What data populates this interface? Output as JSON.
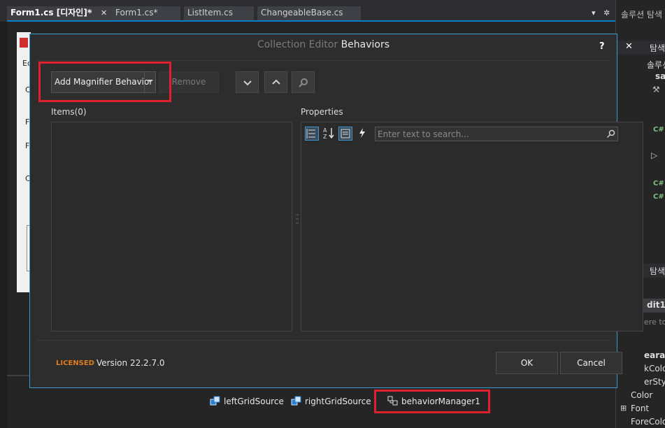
{
  "tabs": [
    {
      "label": "Form1.cs [디자인]*",
      "active": true
    },
    {
      "label": "Form1.cs*",
      "active": false
    },
    {
      "label": "ListItem.cs",
      "active": false
    },
    {
      "label": "ChangeableBase.cs",
      "active": false
    }
  ],
  "tab_controls": {
    "pin": "ᵖ",
    "close": "✕",
    "dropdown": "▾",
    "settings": "✲"
  },
  "form_fragments": [
    "Ed",
    "C",
    "F",
    "F",
    "C"
  ],
  "right_panel": {
    "title": "솔루션 탐색",
    "tab1": "탐색",
    "tree_root_label": "솔루션",
    "tree_item": "sa",
    "csharp": "C#",
    "tab2": "탐색",
    "props_title": "dit1",
    "props_search": "ere to",
    "prop_rows": [
      "earan",
      "kColo",
      "erSty",
      "Color",
      "Font",
      "ForeColo"
    ]
  },
  "dialog": {
    "title_prefix": "Collection Editor",
    "title_main": "Behaviors",
    "help": "?",
    "close": "✕",
    "add_button": "Add Magnifier Behavior",
    "remove_button": "Remove",
    "items_label": "Items(0)",
    "properties_label": "Properties",
    "search_placeholder": "Enter text to search...",
    "licensed": "LICENSED",
    "version": "Version 22.2.7.0",
    "ok": "OK",
    "cancel": "Cancel"
  },
  "tray": [
    {
      "label": "leftGridSource",
      "icon": "data-source-icon"
    },
    {
      "label": "rightGridSource",
      "icon": "data-source-icon"
    },
    {
      "label": "behaviorManager1",
      "icon": "behavior-manager-icon"
    }
  ],
  "colors": {
    "accent": "#007acc",
    "highlight": "#e0202c",
    "licensed": "#e07a1f",
    "dialog_border": "#3d9ad1"
  }
}
